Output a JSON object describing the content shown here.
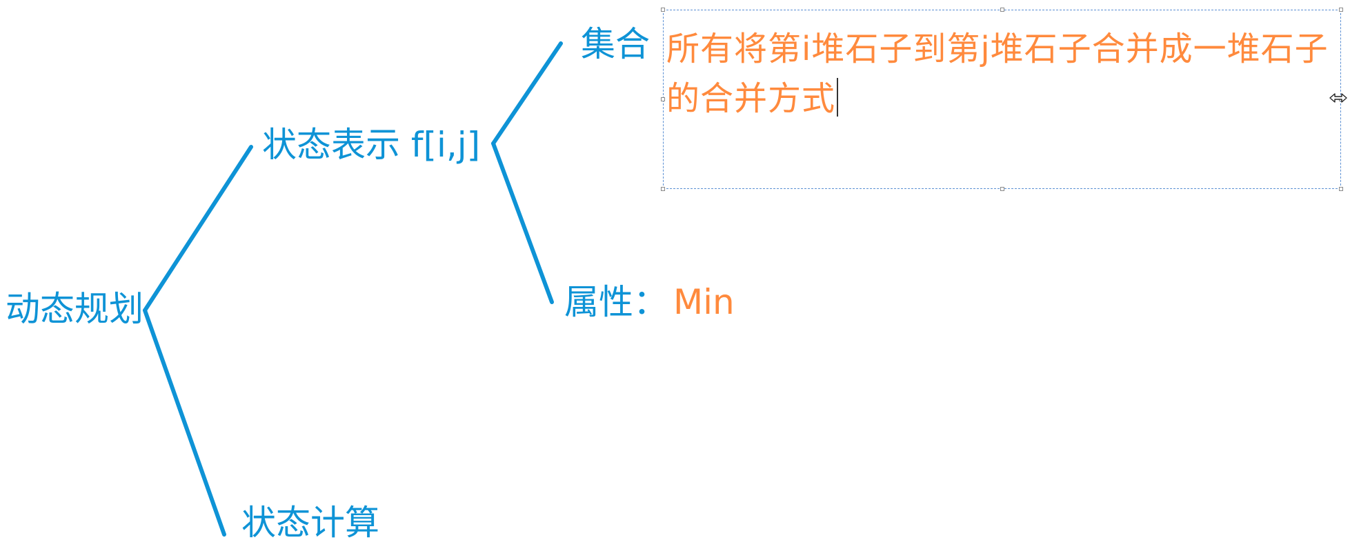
{
  "colors": {
    "branch_line": "#0e93d6",
    "node_text": "#0e93d6",
    "value_text": "#ff8a3d",
    "selection_border": "#5a8fd3"
  },
  "nodes": {
    "root": "动态规划",
    "state_rep": "状态表示 f[i,j]",
    "state_calc": "状态计算",
    "set_label": "集合",
    "attr_label": "属性：",
    "attr_value": "Min"
  },
  "textbox": {
    "content": "所有将第i堆石子到第j堆石子合并成一堆石子的合并方式"
  },
  "icons": {
    "cursor": "resize-horizontal-icon"
  }
}
